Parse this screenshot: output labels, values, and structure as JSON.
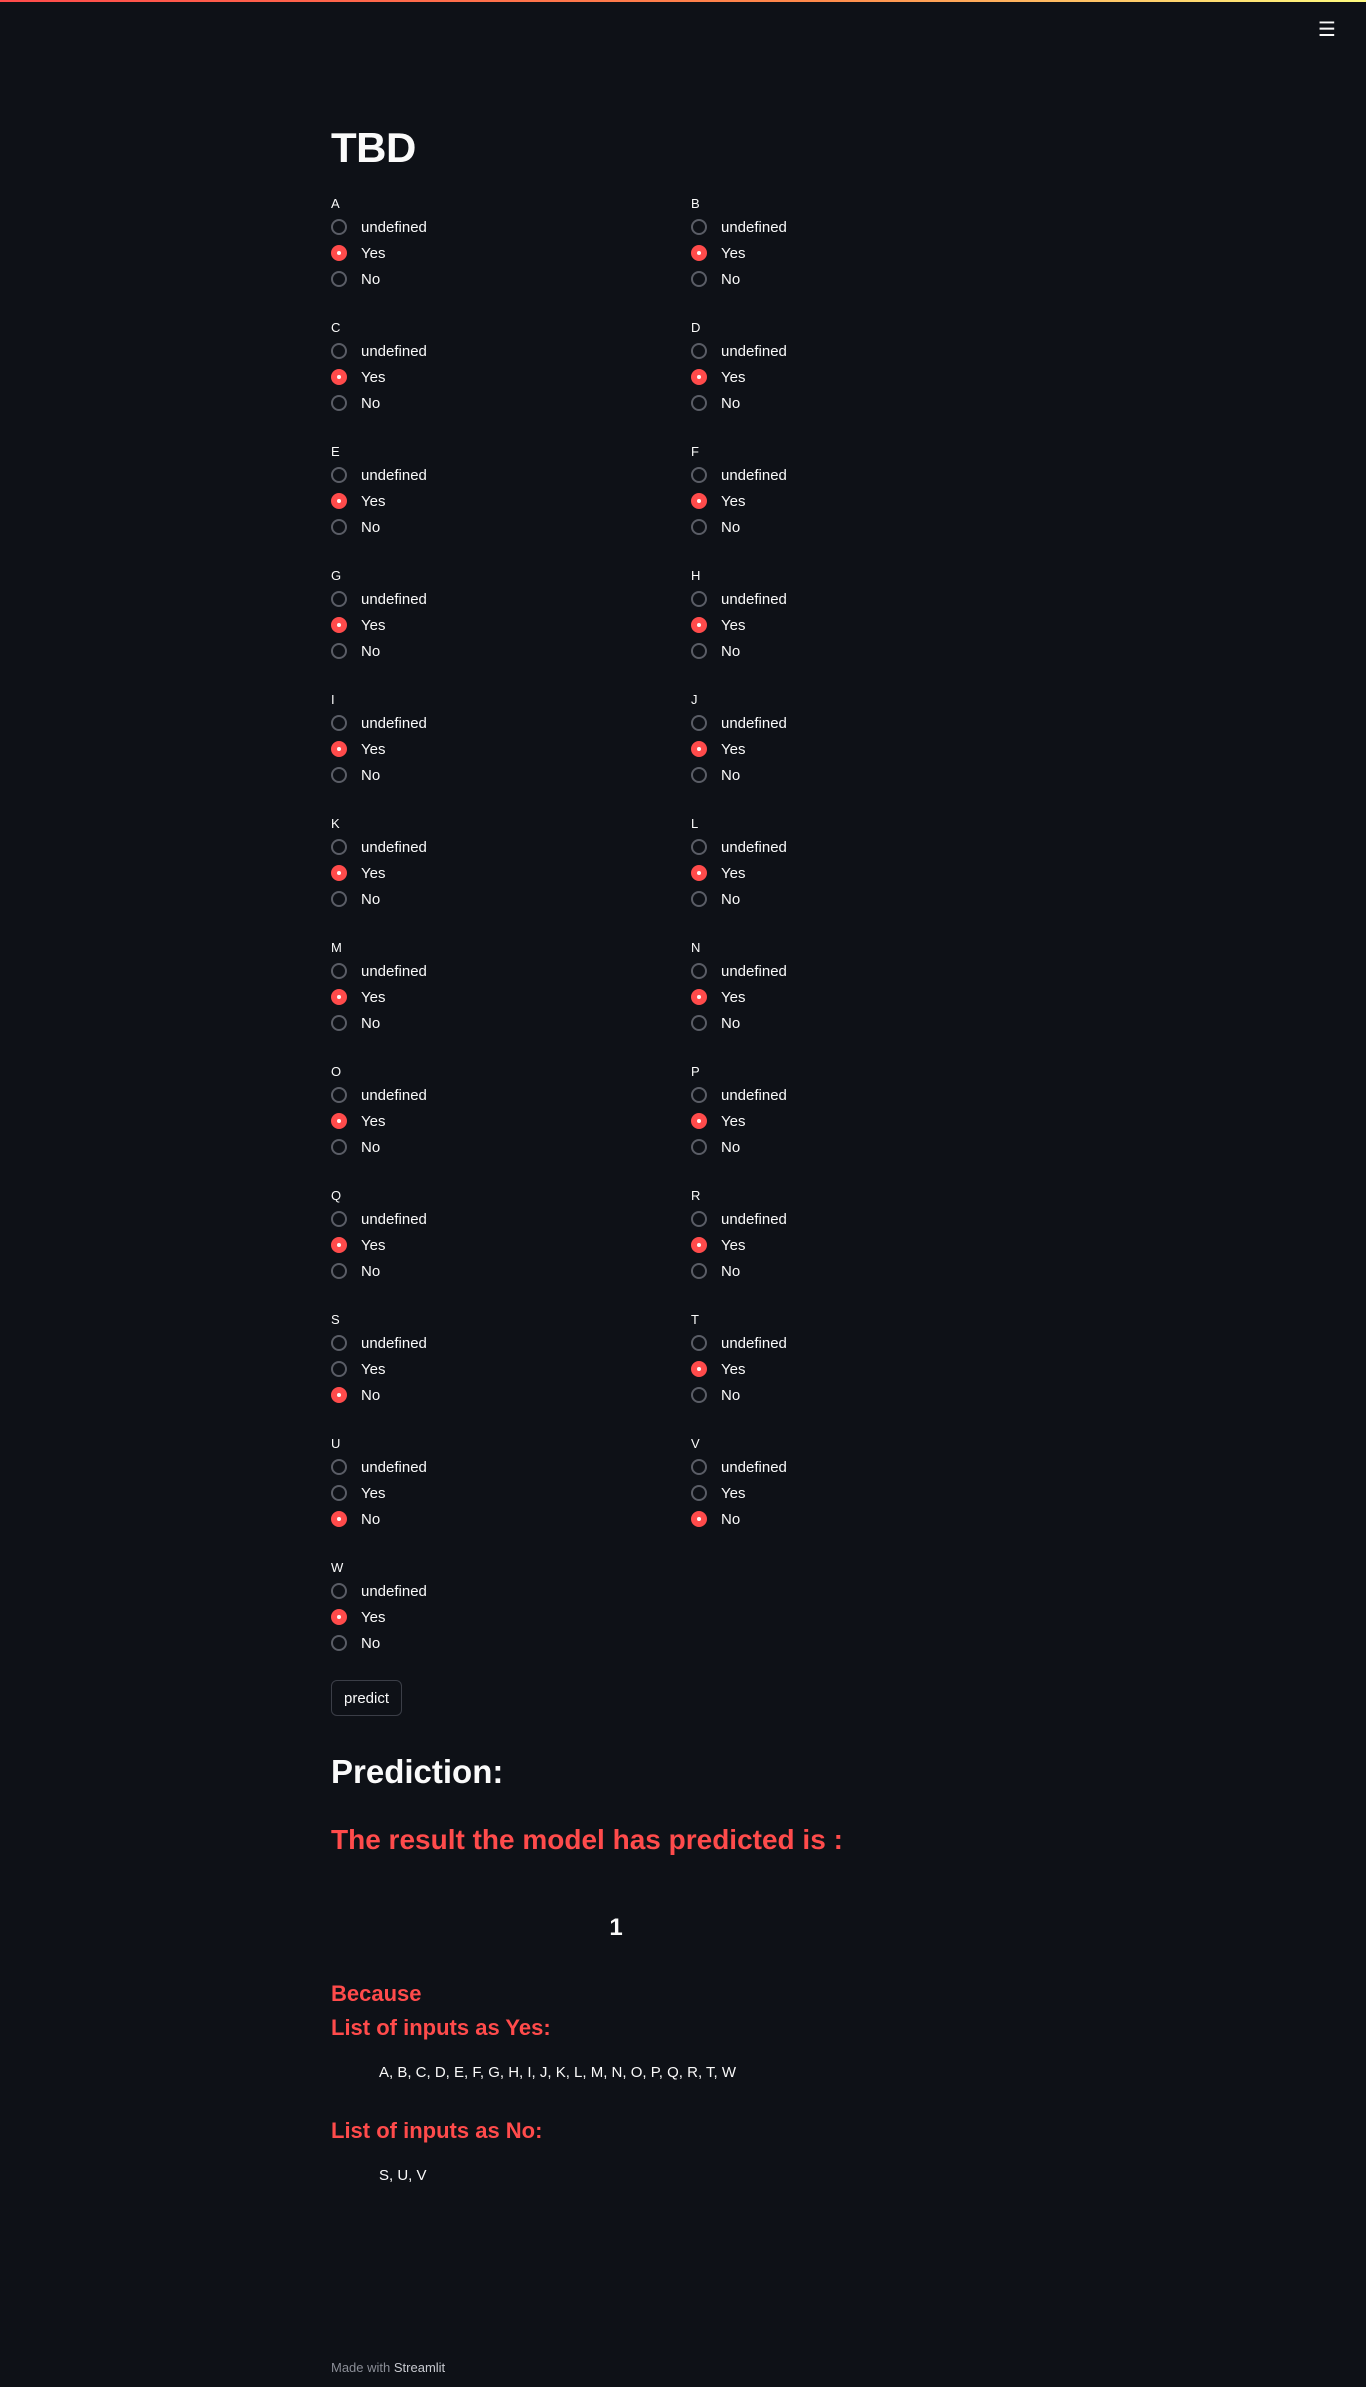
{
  "app": {
    "title": "TBD",
    "menu_icon": "hamburger-menu-icon",
    "accent_color": "#ff4b4b",
    "background_color": "#0e1117"
  },
  "options": [
    "undefined",
    "Yes",
    "No"
  ],
  "questions": [
    {
      "label": "A",
      "selected": "Yes"
    },
    {
      "label": "B",
      "selected": "Yes"
    },
    {
      "label": "C",
      "selected": "Yes"
    },
    {
      "label": "D",
      "selected": "Yes"
    },
    {
      "label": "E",
      "selected": "Yes"
    },
    {
      "label": "F",
      "selected": "Yes"
    },
    {
      "label": "G",
      "selected": "Yes"
    },
    {
      "label": "H",
      "selected": "Yes"
    },
    {
      "label": "I",
      "selected": "Yes"
    },
    {
      "label": "J",
      "selected": "Yes"
    },
    {
      "label": "K",
      "selected": "Yes"
    },
    {
      "label": "L",
      "selected": "Yes"
    },
    {
      "label": "M",
      "selected": "Yes"
    },
    {
      "label": "N",
      "selected": "Yes"
    },
    {
      "label": "O",
      "selected": "Yes"
    },
    {
      "label": "P",
      "selected": "Yes"
    },
    {
      "label": "Q",
      "selected": "Yes"
    },
    {
      "label": "R",
      "selected": "Yes"
    },
    {
      "label": "S",
      "selected": "No"
    },
    {
      "label": "T",
      "selected": "Yes"
    },
    {
      "label": "U",
      "selected": "No"
    },
    {
      "label": "V",
      "selected": "No"
    },
    {
      "label": "W",
      "selected": "Yes"
    }
  ],
  "predict_button": "predict",
  "prediction": {
    "heading": "Prediction:",
    "result_text": "The result the model has predicted is :",
    "value": "1",
    "because": "Because",
    "yes_heading": "List of inputs as Yes:",
    "yes_list": "A, B, C, D, E, F, G, H, I, J, K, L, M, N, O, P, Q, R, T, W",
    "no_heading": "List of inputs as No:",
    "no_list": "S, U, V"
  },
  "footer": {
    "prefix": "Made with",
    "brand": "Streamlit"
  }
}
